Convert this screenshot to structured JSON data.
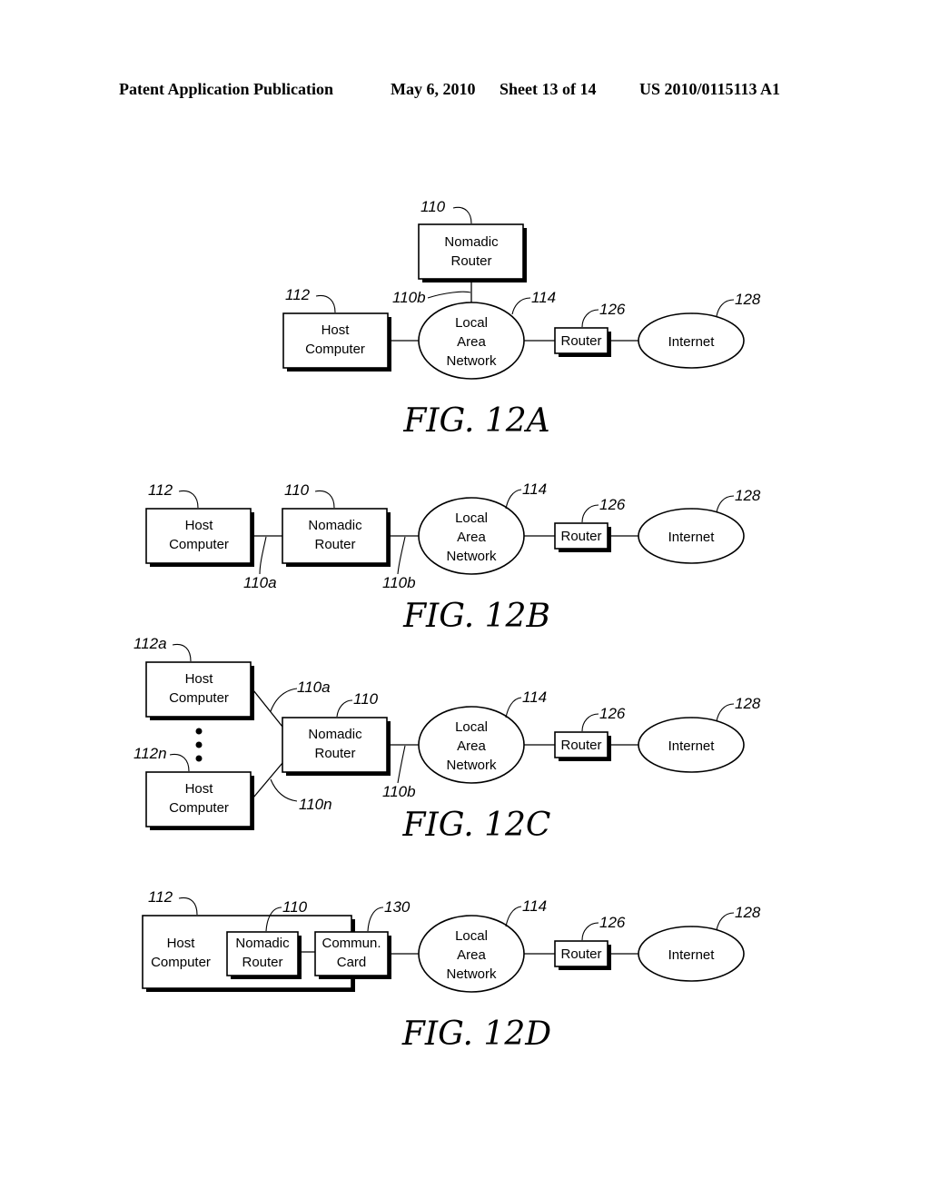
{
  "header": {
    "publication": "Patent Application Publication",
    "date": "May 6, 2010",
    "sheet": "Sheet 13 of 14",
    "number": "US 2010/0115113 A1"
  },
  "figures": [
    {
      "id": "12A",
      "caption": "FIG. 12A",
      "nodes": {
        "nomadic_router": {
          "line1": "Nomadic",
          "line2": "Router",
          "ref": "110"
        },
        "host": {
          "line1": "Host",
          "line2": "Computer",
          "ref": "112"
        },
        "lan": {
          "line1": "Local",
          "line2": "Area",
          "line3": "Network",
          "ref": "114"
        },
        "router": {
          "label": "Router",
          "ref": "126"
        },
        "internet": {
          "label": "Internet",
          "ref": "128"
        }
      },
      "links": {
        "nr_lan": "110b"
      }
    },
    {
      "id": "12B",
      "caption": "FIG. 12B",
      "nodes": {
        "host": {
          "line1": "Host",
          "line2": "Computer",
          "ref": "112"
        },
        "nomadic_router": {
          "line1": "Nomadic",
          "line2": "Router",
          "ref": "110"
        },
        "lan": {
          "line1": "Local",
          "line2": "Area",
          "line3": "Network",
          "ref": "114"
        },
        "router": {
          "label": "Router",
          "ref": "126"
        },
        "internet": {
          "label": "Internet",
          "ref": "128"
        }
      },
      "links": {
        "host_nr": "110a",
        "nr_lan": "110b"
      }
    },
    {
      "id": "12C",
      "caption": "FIG. 12C",
      "nodes": {
        "host_a": {
          "line1": "Host",
          "line2": "Computer",
          "ref": "112a"
        },
        "host_n": {
          "line1": "Host",
          "line2": "Computer",
          "ref": "112n"
        },
        "nomadic_router": {
          "line1": "Nomadic",
          "line2": "Router",
          "ref": "110"
        },
        "lan": {
          "line1": "Local",
          "line2": "Area",
          "line3": "Network",
          "ref": "114"
        },
        "router": {
          "label": "Router",
          "ref": "126"
        },
        "internet": {
          "label": "Internet",
          "ref": "128"
        }
      },
      "links": {
        "host_a_nr": "110a",
        "host_n_nr": "110n",
        "nr_lan": "110b"
      }
    },
    {
      "id": "12D",
      "caption": "FIG. 12D",
      "nodes": {
        "host": {
          "line1": "Host",
          "line2": "Computer",
          "ref": "112"
        },
        "nomadic_router": {
          "line1": "Nomadic",
          "line2": "Router",
          "ref": "110"
        },
        "comm_card": {
          "line1": "Commun.",
          "line2": "Card",
          "ref": "130"
        },
        "lan": {
          "line1": "Local",
          "line2": "Area",
          "line3": "Network",
          "ref": "114"
        },
        "router": {
          "label": "Router",
          "ref": "126"
        },
        "internet": {
          "label": "Internet",
          "ref": "128"
        }
      }
    }
  ]
}
